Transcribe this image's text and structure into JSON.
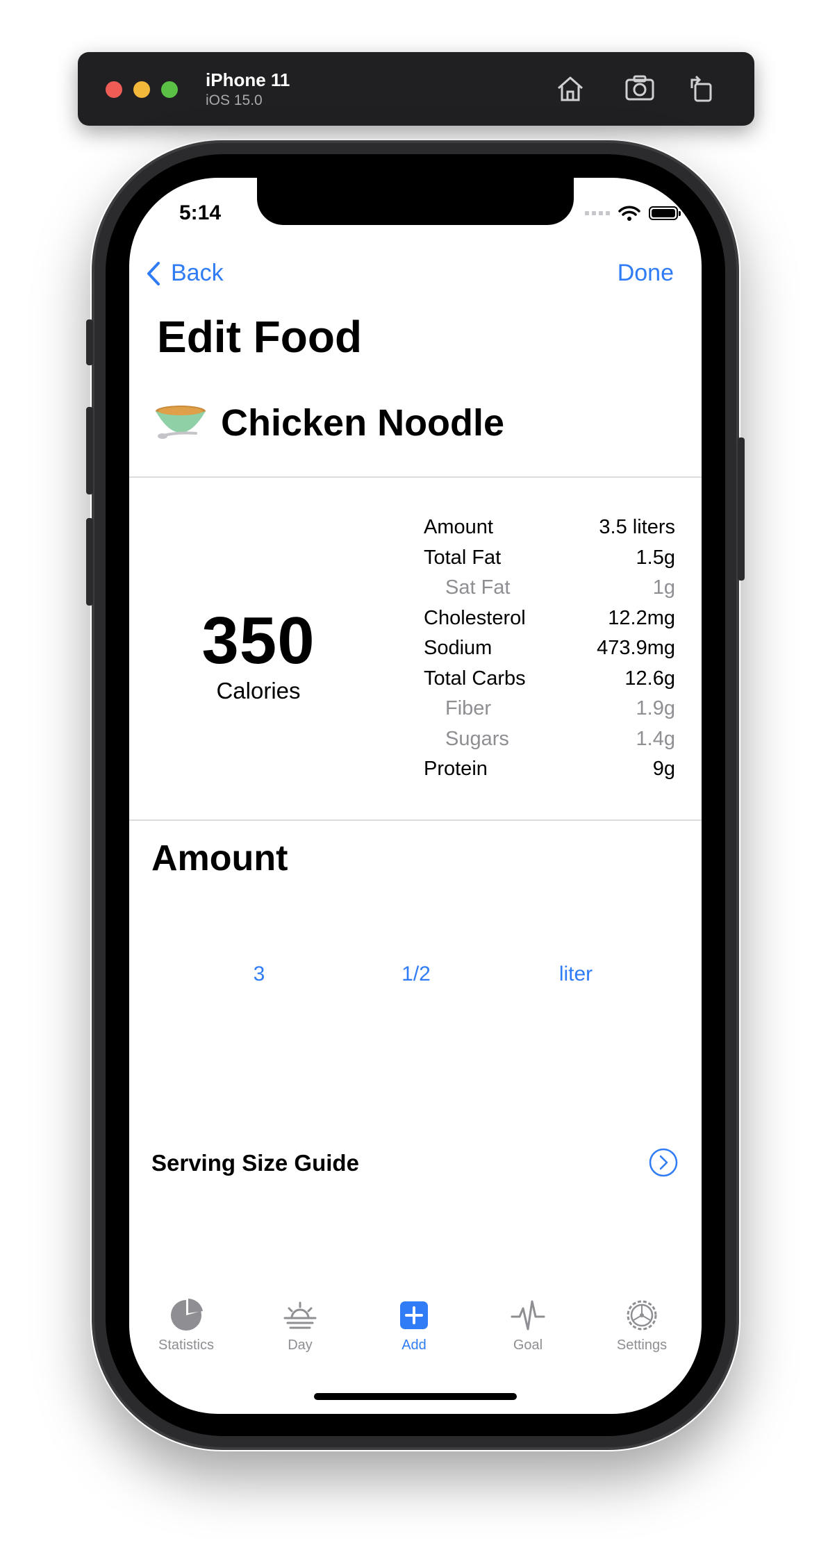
{
  "simulator": {
    "device": "iPhone 11",
    "os": "iOS 15.0",
    "controls": [
      "home-icon",
      "screenshot-icon",
      "rotate-icon"
    ]
  },
  "status_bar": {
    "time": "5:14"
  },
  "nav": {
    "back_label": "Back",
    "done_label": "Done"
  },
  "page": {
    "title": "Edit Food"
  },
  "food": {
    "emoji": "🥣",
    "name": "Chicken Noodle"
  },
  "summary": {
    "calories": "350",
    "calories_label": "Calories"
  },
  "nutrition": [
    {
      "label": "Amount",
      "value": "3.5 liters",
      "sub": false
    },
    {
      "label": "Total Fat",
      "value": "1.5g",
      "sub": false
    },
    {
      "label": "Sat Fat",
      "value": "1g",
      "sub": true
    },
    {
      "label": "Cholesterol",
      "value": "12.2mg",
      "sub": false
    },
    {
      "label": "Sodium",
      "value": "473.9mg",
      "sub": false
    },
    {
      "label": "Total Carbs",
      "value": "12.6g",
      "sub": false
    },
    {
      "label": "Fiber",
      "value": "1.9g",
      "sub": true
    },
    {
      "label": "Sugars",
      "value": "1.4g",
      "sub": true
    },
    {
      "label": "Protein",
      "value": "9g",
      "sub": false
    }
  ],
  "amount_section": {
    "title": "Amount",
    "picker": {
      "whole": "3",
      "fraction": "1/2",
      "unit": "liter"
    }
  },
  "serving_guide": {
    "label": "Serving Size Guide"
  },
  "tab_bar": {
    "tabs": [
      {
        "label": "Statistics",
        "icon": "pie-chart-icon",
        "active": false
      },
      {
        "label": "Day",
        "icon": "sunrise-icon",
        "active": false
      },
      {
        "label": "Add",
        "icon": "plus-square-icon",
        "active": true
      },
      {
        "label": "Goal",
        "icon": "waveform-icon",
        "active": false
      },
      {
        "label": "Settings",
        "icon": "gear-icon",
        "active": false
      }
    ]
  },
  "colors": {
    "accent": "#2f7cf6",
    "secondary_text": "#8e8e93",
    "divider": "#dcdcde"
  }
}
